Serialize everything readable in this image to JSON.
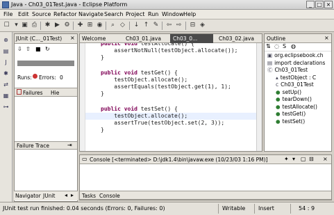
{
  "window": {
    "title": "Java - Ch03_01Test.java - Eclipse Platform",
    "min": "_",
    "max": "□",
    "close": "×"
  },
  "menu": [
    "File",
    "Edit",
    "Source",
    "Refactor",
    "Navigate",
    "Search",
    "Project",
    "Run",
    "Window",
    "Help"
  ],
  "junit": {
    "tab_label": "JUnit (C..._01Test)",
    "runs_label": "Runs:",
    "errors_label": "Errors:",
    "errors_value": "0",
    "failures_tab": "Failures",
    "hierarchy_tab": "Hie",
    "failure_trace_label": "Failure Trace",
    "progress_fraction": 1.0,
    "progress_color": "#8a8a8a"
  },
  "bottom_tabs_left": [
    "Navigator",
    "JUnit"
  ],
  "editor": {
    "tabs": [
      "Welcome",
      "Ch03_01.java",
      "Ch03_0...",
      "Ch03_02.java"
    ],
    "active_tab_index": 2,
    "lines": [
      "public void testAllocate() {",
      "    assertNotNull(testObject.allocate());",
      "}",
      "",
      "public void testGet() {",
      "    testObject.allocate();",
      "    assertEquals(testObject.get(1), 1);",
      "}",
      "",
      "public void testSet() {",
      "    testObject.allocate();",
      "    assertTrue(testObject.set(2, 3));",
      "}"
    ]
  },
  "outline": {
    "title": "Outline",
    "items": [
      {
        "label": "org.eclipsebook.ch",
        "indent": 0,
        "icon": "package-icon"
      },
      {
        "label": "import declarations",
        "indent": 0,
        "icon": "import-icon"
      },
      {
        "label": "Ch03_01Test",
        "indent": 0,
        "icon": "class-icon"
      },
      {
        "label": "testObject : C",
        "indent": 1,
        "icon": "field-icon"
      },
      {
        "label": "Ch03_01Test",
        "indent": 1,
        "icon": "constructor-icon"
      },
      {
        "label": "setUp()",
        "indent": 1,
        "icon": "method-icon"
      },
      {
        "label": "tearDown()",
        "indent": 1,
        "icon": "method-icon"
      },
      {
        "label": "testAllocate()",
        "indent": 1,
        "icon": "method-icon"
      },
      {
        "label": "testGet()",
        "indent": 1,
        "icon": "method-icon"
      },
      {
        "label": "testSet()",
        "indent": 1,
        "icon": "method-icon"
      }
    ]
  },
  "console": {
    "title": "Console [<terminated> D:\\jdk1.4\\bin\\javaw.exe (10/23/03 1:16 PM)]",
    "bottom_tabs": [
      "Tasks",
      "Console"
    ]
  },
  "status": {
    "message": "JUnit test run finished: 0.04 seconds (Errors: 0, Failures: 0)",
    "writable": "Writable",
    "insert": "Insert",
    "position": "54 : 9"
  }
}
